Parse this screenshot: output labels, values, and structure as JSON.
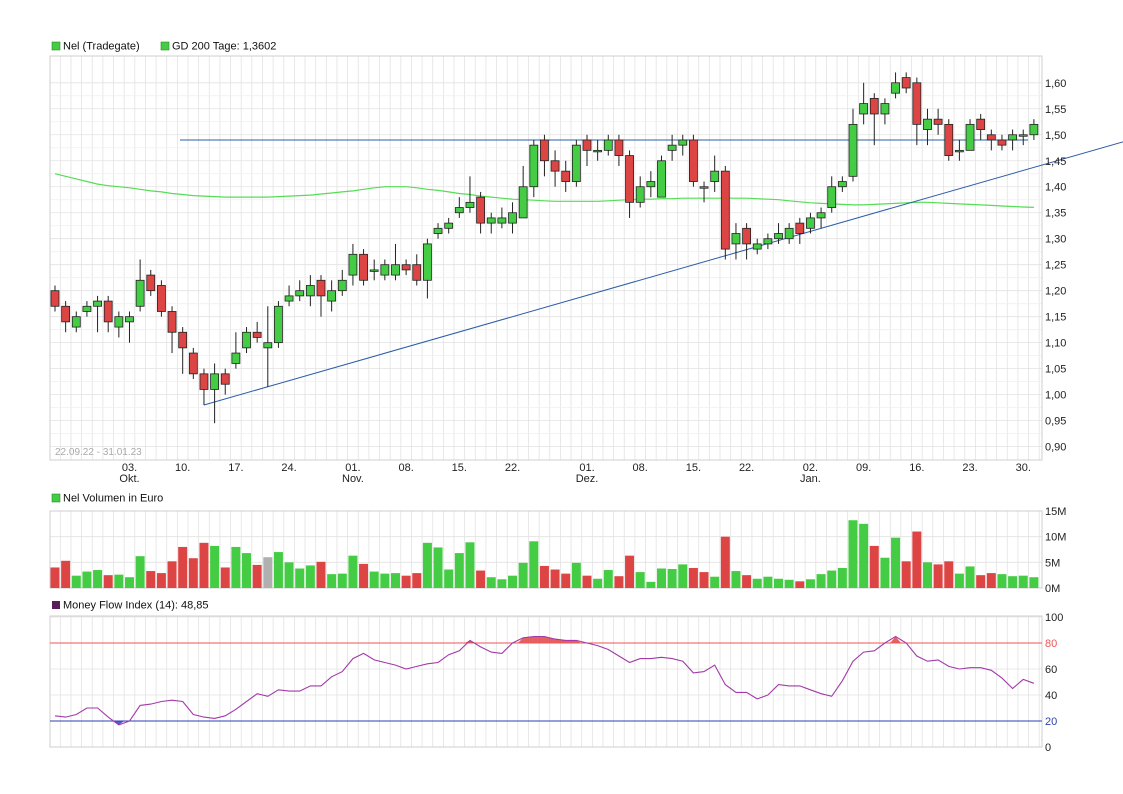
{
  "colors": {
    "up": "#44cc44",
    "down": "#dd4444",
    "neutral": "#b0b0b0",
    "gd200": "#55dd55",
    "trendline": "#2a5ca8",
    "mfi": "#a23aa8",
    "mfi_hi_line": "#ee5555",
    "mfi_lo_line": "#2f3fb0",
    "mfi_hi_fill": "#e04444",
    "mfi_lo_fill": "#3a3ad0",
    "grid": "#e2e2e2",
    "legend_mfi": "#5a1e5a"
  },
  "price_panel": {
    "legend": [
      {
        "label": "Nel (Tradegate)",
        "color": "#44cc44"
      },
      {
        "label": "GD 200 Tage: 1,3602",
        "color": "#44cc44"
      }
    ],
    "date_range": "22.09.22 - 31.01.23"
  },
  "volume_panel": {
    "legend": {
      "label": "Nel Volumen in Euro",
      "color": "#44cc44"
    }
  },
  "mfi_panel": {
    "legend": {
      "label": "Money Flow Index (14): 48,85",
      "color": "#5a1e5a"
    }
  },
  "chart_data": [
    {
      "type": "candlestick",
      "ylim": [
        0.88,
        1.64
      ],
      "y_ticks": [
        "0,90",
        "0,95",
        "1,00",
        "1,05",
        "1,10",
        "1,15",
        "1,20",
        "1,25",
        "1,30",
        "1,35",
        "1,40",
        "1,45",
        "1,50",
        "1,55",
        "1,60"
      ],
      "x_ticks": [
        {
          "i": 7,
          "label": "03.",
          "sub": "Okt."
        },
        {
          "i": 12,
          "label": "10.",
          "sub": ""
        },
        {
          "i": 17,
          "label": "17.",
          "sub": ""
        },
        {
          "i": 22,
          "label": "24.",
          "sub": ""
        },
        {
          "i": 28,
          "label": "01.",
          "sub": "Nov."
        },
        {
          "i": 33,
          "label": "08.",
          "sub": ""
        },
        {
          "i": 38,
          "label": "15.",
          "sub": ""
        },
        {
          "i": 43,
          "label": "22.",
          "sub": ""
        },
        {
          "i": 50,
          "label": "01.",
          "sub": "Dez."
        },
        {
          "i": 55,
          "label": "08.",
          "sub": ""
        },
        {
          "i": 60,
          "label": "15.",
          "sub": ""
        },
        {
          "i": 65,
          "label": "22.",
          "sub": ""
        },
        {
          "i": 71,
          "label": "02.",
          "sub": "Jan."
        },
        {
          "i": 76,
          "label": "09.",
          "sub": ""
        },
        {
          "i": 81,
          "label": "16.",
          "sub": ""
        },
        {
          "i": 86,
          "label": "23.",
          "sub": ""
        },
        {
          "i": 91,
          "label": "30.",
          "sub": ""
        }
      ],
      "candles": [
        [
          1.2,
          1.17,
          1.21,
          1.16
        ],
        [
          1.17,
          1.14,
          1.18,
          1.12
        ],
        [
          1.13,
          1.15,
          1.16,
          1.12
        ],
        [
          1.16,
          1.17,
          1.18,
          1.15
        ],
        [
          1.17,
          1.18,
          1.19,
          1.12
        ],
        [
          1.18,
          1.14,
          1.19,
          1.12
        ],
        [
          1.13,
          1.15,
          1.16,
          1.11
        ],
        [
          1.14,
          1.15,
          1.16,
          1.1
        ],
        [
          1.17,
          1.22,
          1.26,
          1.16
        ],
        [
          1.23,
          1.2,
          1.24,
          1.19
        ],
        [
          1.21,
          1.16,
          1.22,
          1.15
        ],
        [
          1.16,
          1.12,
          1.17,
          1.08
        ],
        [
          1.12,
          1.09,
          1.13,
          1.04
        ],
        [
          1.08,
          1.04,
          1.09,
          1.03
        ],
        [
          1.04,
          1.01,
          1.05,
          0.98
        ],
        [
          1.01,
          1.04,
          1.06,
          0.945
        ],
        [
          1.04,
          1.02,
          1.05,
          1.0
        ],
        [
          1.06,
          1.08,
          1.12,
          1.05
        ],
        [
          1.09,
          1.12,
          1.13,
          1.08
        ],
        [
          1.12,
          1.11,
          1.14,
          1.1
        ],
        [
          1.09,
          1.1,
          1.17,
          1.015
        ],
        [
          1.1,
          1.17,
          1.18,
          1.09
        ],
        [
          1.18,
          1.19,
          1.21,
          1.17
        ],
        [
          1.19,
          1.2,
          1.22,
          1.18
        ],
        [
          1.19,
          1.21,
          1.23,
          1.17
        ],
        [
          1.22,
          1.19,
          1.23,
          1.15
        ],
        [
          1.18,
          1.2,
          1.22,
          1.16
        ],
        [
          1.2,
          1.22,
          1.24,
          1.19
        ],
        [
          1.23,
          1.27,
          1.29,
          1.21
        ],
        [
          1.27,
          1.22,
          1.28,
          1.21
        ],
        [
          1.24,
          1.24,
          1.26,
          1.22
        ],
        [
          1.23,
          1.25,
          1.26,
          1.22
        ],
        [
          1.23,
          1.25,
          1.29,
          1.22
        ],
        [
          1.25,
          1.24,
          1.26,
          1.23
        ],
        [
          1.25,
          1.22,
          1.27,
          1.21
        ],
        [
          1.22,
          1.29,
          1.3,
          1.185
        ],
        [
          1.31,
          1.32,
          1.33,
          1.3
        ],
        [
          1.32,
          1.33,
          1.34,
          1.31
        ],
        [
          1.35,
          1.36,
          1.38,
          1.34
        ],
        [
          1.36,
          1.37,
          1.42,
          1.35
        ],
        [
          1.38,
          1.33,
          1.39,
          1.31
        ],
        [
          1.33,
          1.34,
          1.35,
          1.31
        ],
        [
          1.33,
          1.34,
          1.36,
          1.32
        ],
        [
          1.33,
          1.35,
          1.37,
          1.31
        ],
        [
          1.34,
          1.4,
          1.44,
          1.34
        ],
        [
          1.4,
          1.48,
          1.49,
          1.38
        ],
        [
          1.49,
          1.45,
          1.5,
          1.42
        ],
        [
          1.45,
          1.43,
          1.47,
          1.4
        ],
        [
          1.43,
          1.41,
          1.45,
          1.39
        ],
        [
          1.41,
          1.48,
          1.49,
          1.4
        ],
        [
          1.49,
          1.47,
          1.5,
          1.44
        ],
        [
          1.47,
          1.47,
          1.49,
          1.45
        ],
        [
          1.47,
          1.49,
          1.5,
          1.46
        ],
        [
          1.49,
          1.46,
          1.5,
          1.44
        ],
        [
          1.46,
          1.37,
          1.47,
          1.34
        ],
        [
          1.37,
          1.4,
          1.42,
          1.36
        ],
        [
          1.4,
          1.41,
          1.43,
          1.38
        ],
        [
          1.38,
          1.45,
          1.46,
          1.38
        ],
        [
          1.47,
          1.48,
          1.5,
          1.45
        ],
        [
          1.48,
          1.49,
          1.5,
          1.46
        ],
        [
          1.49,
          1.41,
          1.5,
          1.4
        ],
        [
          1.4,
          1.4,
          1.41,
          1.37
        ],
        [
          1.41,
          1.43,
          1.46,
          1.39
        ],
        [
          1.43,
          1.28,
          1.44,
          1.26
        ],
        [
          1.29,
          1.31,
          1.33,
          1.26
        ],
        [
          1.32,
          1.29,
          1.33,
          1.26
        ],
        [
          1.28,
          1.29,
          1.3,
          1.27
        ],
        [
          1.29,
          1.3,
          1.31,
          1.28
        ],
        [
          1.3,
          1.31,
          1.33,
          1.29
        ],
        [
          1.3,
          1.32,
          1.33,
          1.29
        ],
        [
          1.33,
          1.31,
          1.34,
          1.29
        ],
        [
          1.32,
          1.34,
          1.35,
          1.31
        ],
        [
          1.34,
          1.35,
          1.36,
          1.32
        ],
        [
          1.36,
          1.4,
          1.42,
          1.35
        ],
        [
          1.4,
          1.41,
          1.42,
          1.39
        ],
        [
          1.42,
          1.52,
          1.55,
          1.41
        ],
        [
          1.54,
          1.56,
          1.6,
          1.52
        ],
        [
          1.57,
          1.54,
          1.58,
          1.48
        ],
        [
          1.54,
          1.56,
          1.57,
          1.52
        ],
        [
          1.58,
          1.6,
          1.62,
          1.57
        ],
        [
          1.61,
          1.59,
          1.62,
          1.58
        ],
        [
          1.6,
          1.52,
          1.61,
          1.48
        ],
        [
          1.51,
          1.53,
          1.55,
          1.48
        ],
        [
          1.53,
          1.52,
          1.55,
          1.5
        ],
        [
          1.52,
          1.46,
          1.53,
          1.45
        ],
        [
          1.47,
          1.47,
          1.49,
          1.45
        ],
        [
          1.47,
          1.52,
          1.53,
          1.47
        ],
        [
          1.53,
          1.51,
          1.54,
          1.49
        ],
        [
          1.5,
          1.49,
          1.51,
          1.47
        ],
        [
          1.49,
          1.48,
          1.5,
          1.47
        ],
        [
          1.49,
          1.5,
          1.51,
          1.47
        ],
        [
          1.5,
          1.5,
          1.51,
          1.48
        ],
        [
          1.5,
          1.52,
          1.53,
          1.49
        ]
      ],
      "gd200": [
        1.425,
        1.42,
        1.415,
        1.41,
        1.405,
        1.402,
        1.4,
        1.398,
        1.395,
        1.392,
        1.39,
        1.387,
        1.385,
        1.383,
        1.382,
        1.381,
        1.38,
        1.38,
        1.38,
        1.38,
        1.38,
        1.381,
        1.382,
        1.383,
        1.384,
        1.386,
        1.388,
        1.39,
        1.392,
        1.395,
        1.398,
        1.4,
        1.4,
        1.4,
        1.398,
        1.395,
        1.393,
        1.39,
        1.387,
        1.385,
        1.382,
        1.38,
        1.378,
        1.376,
        1.375,
        1.374,
        1.373,
        1.372,
        1.372,
        1.372,
        1.372,
        1.372,
        1.373,
        1.374,
        1.375,
        1.376,
        1.376,
        1.377,
        1.377,
        1.378,
        1.378,
        1.378,
        1.378,
        1.378,
        1.378,
        1.378,
        1.377,
        1.376,
        1.375,
        1.373,
        1.371,
        1.369,
        1.368,
        1.367,
        1.366,
        1.365,
        1.365,
        1.366,
        1.367,
        1.368,
        1.369,
        1.37,
        1.37,
        1.369,
        1.368,
        1.367,
        1.366,
        1.365,
        1.364,
        1.363,
        1.362,
        1.361,
        1.3602
      ],
      "resistance": 1.49,
      "trendline": {
        "from": {
          "i": 14,
          "y": 0.98
        },
        "to": {
          "i": 101,
          "y": 1.49
        }
      }
    },
    {
      "type": "bar",
      "unit": "EUR",
      "ylim": [
        0,
        15
      ],
      "y_ticks": [
        "0M",
        "5M",
        "10M",
        "15M"
      ],
      "values": [
        4,
        5.3,
        2.4,
        3.2,
        3.5,
        2.5,
        2.6,
        2.1,
        6.2,
        3.3,
        2.9,
        5.2,
        8,
        5.8,
        8.8,
        8.2,
        4,
        8,
        6.8,
        4.5,
        6,
        7,
        5,
        3.8,
        4.4,
        5.1,
        2.7,
        2.8,
        6.3,
        4.7,
        3.2,
        2.8,
        2.9,
        2.4,
        2.9,
        8.8,
        7.9,
        3.6,
        6.8,
        8.9,
        3.4,
        2.1,
        1.7,
        2.4,
        4.9,
        9.1,
        4.3,
        3.6,
        2.8,
        4.9,
        2.4,
        1.8,
        3.5,
        2.3,
        6.3,
        3.1,
        1.2,
        3.8,
        3.7,
        4.6,
        3.9,
        3.1,
        2.2,
        10,
        3.3,
        2.5,
        1.8,
        2.2,
        1.8,
        1.6,
        1.3,
        1.7,
        2.7,
        3.4,
        3.9,
        13.2,
        12.5,
        8.2,
        5.9,
        9.8,
        5.2,
        11,
        5,
        4.6,
        5.2,
        2.8,
        4.2,
        2.5,
        2.9,
        2.7,
        2.3,
        2.4,
        2.1
      ],
      "directions": [
        "d",
        "d",
        "u",
        "u",
        "u",
        "d",
        "u",
        "u",
        "u",
        "d",
        "d",
        "d",
        "d",
        "d",
        "d",
        "u",
        "d",
        "u",
        "u",
        "d",
        "n",
        "u",
        "u",
        "u",
        "u",
        "d",
        "u",
        "u",
        "u",
        "d",
        "u",
        "u",
        "u",
        "d",
        "d",
        "u",
        "u",
        "u",
        "u",
        "u",
        "d",
        "u",
        "u",
        "u",
        "u",
        "u",
        "d",
        "d",
        "d",
        "u",
        "d",
        "u",
        "u",
        "d",
        "d",
        "u",
        "u",
        "u",
        "u",
        "u",
        "d",
        "d",
        "u",
        "d",
        "u",
        "d",
        "u",
        "u",
        "u",
        "u",
        "d",
        "u",
        "u",
        "u",
        "u",
        "u",
        "u",
        "d",
        "u",
        "u",
        "d",
        "d",
        "u",
        "d",
        "d",
        "u",
        "u",
        "d",
        "d",
        "u",
        "u",
        "u",
        "u"
      ]
    },
    {
      "type": "line",
      "name": "Money Flow Index (14)",
      "ylim": [
        0,
        100
      ],
      "y_ticks": [
        "0",
        "20",
        "40",
        "60",
        "80",
        "100"
      ],
      "levels": {
        "upper": 80,
        "lower": 20
      },
      "values": [
        24,
        23,
        25,
        30,
        30,
        23,
        17,
        20,
        32,
        33,
        35,
        36,
        35,
        25,
        23,
        22,
        24,
        29,
        35,
        41,
        39,
        44,
        43,
        43,
        47,
        47,
        54,
        58,
        68,
        72,
        67,
        65,
        63,
        60,
        62,
        64,
        65,
        71,
        74,
        82,
        77,
        73,
        72,
        80,
        84,
        85,
        85,
        83,
        82,
        82,
        80,
        78,
        75,
        70,
        65,
        68,
        68,
        69,
        68,
        66,
        57,
        58,
        63,
        48,
        42,
        42,
        37,
        40,
        48,
        47,
        47,
        44,
        41,
        39,
        51,
        66,
        73,
        74,
        80,
        85,
        80,
        70,
        66,
        67,
        62,
        60,
        61,
        61,
        59,
        53,
        45,
        52,
        49
      ]
    }
  ]
}
